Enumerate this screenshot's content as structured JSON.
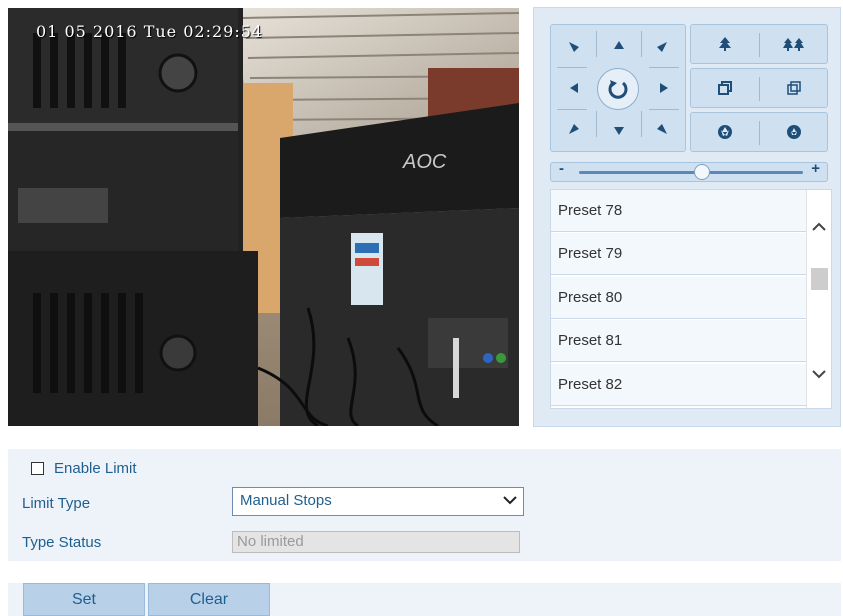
{
  "video": {
    "osd_text": "01 05 2016 Tue 02:29:54",
    "monitor_brand": "AOC"
  },
  "ptz": {
    "speed_level": 0.55,
    "icons": {
      "up_left": "arrow-up-left-icon",
      "up": "arrow-up-icon",
      "up_right": "arrow-up-right-icon",
      "left": "arrow-left-icon",
      "auto": "auto-rotate-icon",
      "right": "arrow-right-icon",
      "down_left": "arrow-down-left-icon",
      "down": "arrow-down-icon",
      "down_right": "arrow-down-right-icon",
      "zoom_in": "zoom-in-tree-icon",
      "zoom_out": "zoom-out-trees-icon",
      "focus_near": "focus-near-icon",
      "focus_far": "focus-far-icon",
      "iris_open": "iris-open-icon",
      "iris_close": "iris-close-icon"
    },
    "speed_minus": "-",
    "speed_plus": "+",
    "presets": [
      "Preset 78",
      "Preset 79",
      "Preset 80",
      "Preset 81",
      "Preset 82"
    ]
  },
  "settings": {
    "enable_limit_label": "Enable Limit",
    "enable_limit_checked": false,
    "limit_type_label": "Limit Type",
    "limit_type_value": "Manual Stops",
    "type_status_label": "Type Status",
    "type_status_value": "No limited"
  },
  "buttons": {
    "set_label": "Set",
    "clear_label": "Clear"
  },
  "colors": {
    "accent_text": "#1f5f8f",
    "panel_bg": "#dfeaf5",
    "button_bg": "#b9d0e9"
  }
}
